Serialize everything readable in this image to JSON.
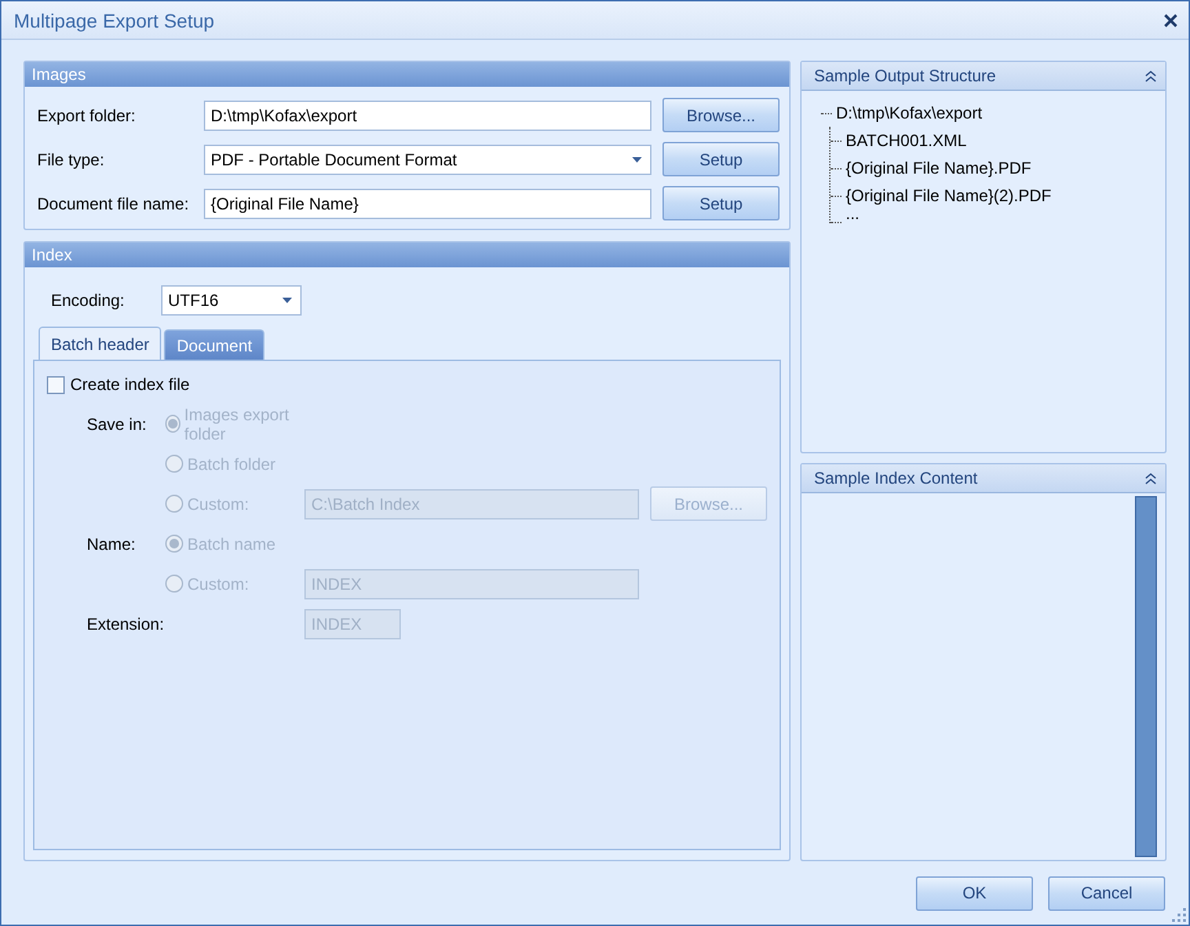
{
  "window": {
    "title": "Multipage Export Setup"
  },
  "images": {
    "title": "Images",
    "rows": [
      {
        "label": "Export folder:",
        "kind": "text",
        "value": "D:\\tmp\\Kofax\\export",
        "button": "Browse..."
      },
      {
        "label": "File type:",
        "kind": "dropdown",
        "value": "PDF - Portable Document Format",
        "button": "Setup"
      },
      {
        "label": "Document file name:",
        "kind": "text",
        "value": "{Original File Name}",
        "button": "Setup"
      }
    ]
  },
  "index": {
    "title": "Index",
    "encoding": {
      "label": "Encoding:",
      "value": "UTF16"
    },
    "tabs": [
      {
        "label": "Batch header",
        "selected": true
      },
      {
        "label": "Document",
        "selected": false
      }
    ],
    "create_index_file": {
      "label": "Create index file",
      "checked": false
    },
    "save_in": {
      "label": "Save in:",
      "options": [
        {
          "label": "Images export folder",
          "selected": true
        },
        {
          "label": "Batch folder",
          "selected": false
        },
        {
          "label": "Custom:",
          "selected": false,
          "value": "C:\\Batch Index",
          "button": "Browse..."
        }
      ]
    },
    "name": {
      "label": "Name:",
      "options": [
        {
          "label": "Batch name",
          "selected": true
        },
        {
          "label": "Custom:",
          "selected": false,
          "value": "INDEX"
        }
      ]
    },
    "extension": {
      "label": "Extension:",
      "value": "INDEX"
    }
  },
  "output_structure": {
    "title": "Sample Output Structure",
    "tree": [
      {
        "label": "D:\\tmp\\Kofax\\export",
        "children": [
          {
            "label": "BATCH001.XML"
          },
          {
            "label": "{Original File Name}.PDF"
          },
          {
            "label": "{Original File Name}(2).PDF"
          },
          {
            "label": "..."
          }
        ]
      }
    ]
  },
  "index_content": {
    "title": "Sample Index Content"
  },
  "buttons": [
    {
      "label": "OK"
    },
    {
      "label": "Cancel"
    }
  ]
}
